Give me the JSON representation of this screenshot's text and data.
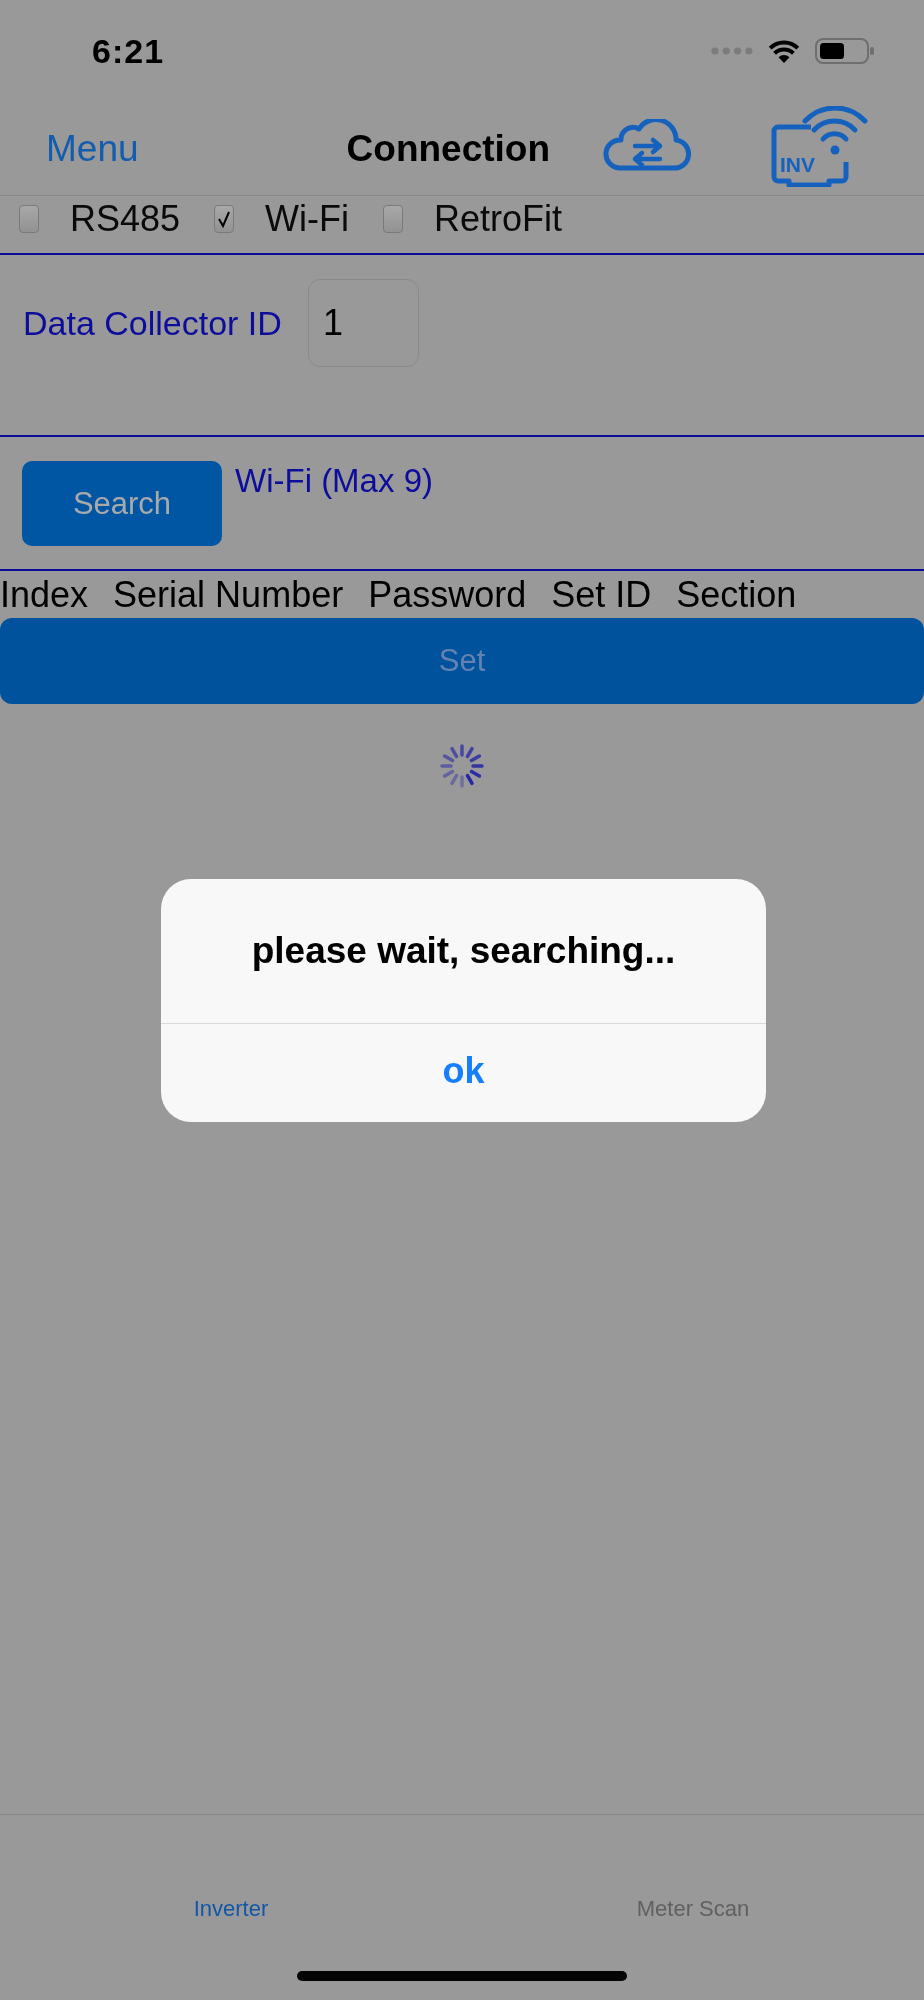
{
  "status_bar": {
    "time": "6:21"
  },
  "nav_bar": {
    "left_button": "Menu",
    "title": "Connection",
    "inverter_icon_label": "INV"
  },
  "connection_types": [
    {
      "label": "RS485",
      "checked": false
    },
    {
      "label": "Wi-Fi",
      "checked": true
    },
    {
      "label": "RetroFit",
      "checked": false
    }
  ],
  "data_collector": {
    "label": "Data Collector ID",
    "value": "1"
  },
  "search": {
    "button": "Search",
    "label": "Wi-Fi (Max 9)"
  },
  "table": {
    "columns": [
      "Index",
      "Serial Number",
      "Password",
      "Set ID",
      "Section"
    ]
  },
  "set_button": {
    "label": "Set",
    "disabled": true
  },
  "loading": true,
  "alert": {
    "message": "please wait, searching...",
    "buttons": [
      "ok"
    ]
  },
  "tab_bar": {
    "tabs": [
      {
        "label": "Inverter",
        "selected": true
      },
      {
        "label": "Meter Scan",
        "selected": false
      }
    ]
  }
}
